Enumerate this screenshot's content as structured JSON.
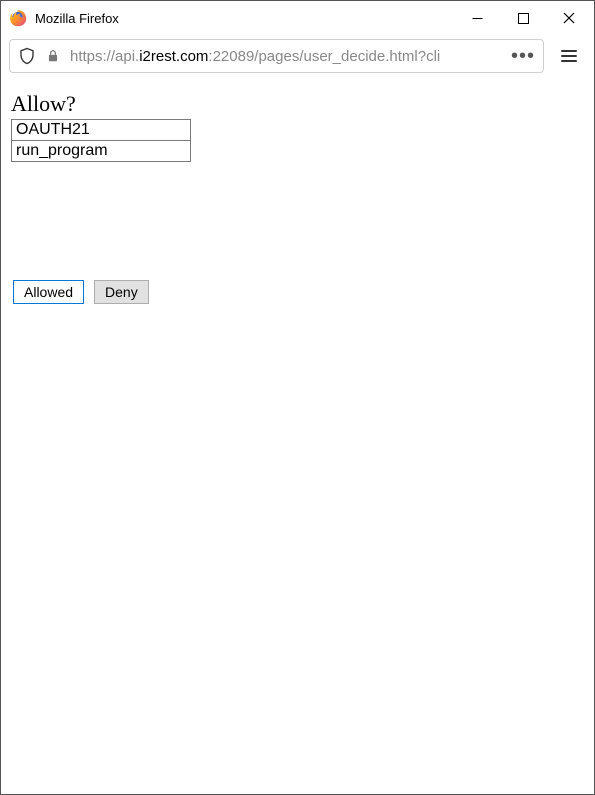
{
  "window": {
    "title": "Mozilla Firefox"
  },
  "addressbar": {
    "url_proto": "https://",
    "url_sub": "api.",
    "url_domain": "i2rest.com",
    "url_port": ":22089",
    "url_path": "/pages/user_decide.html?cli",
    "ellipsis": "•••"
  },
  "page": {
    "heading": "Allow?",
    "scopes": [
      "OAUTH21",
      "run_program"
    ],
    "allowed_label": "Allowed",
    "deny_label": "Deny"
  }
}
